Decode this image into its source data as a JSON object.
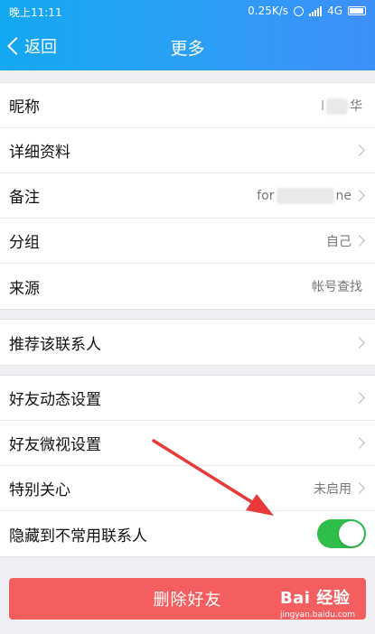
{
  "status_bar": {
    "time": "晚上11:11",
    "network_speed": "0.25K/s",
    "network_type": "4G"
  },
  "nav": {
    "back_label": "返回",
    "title": "更多"
  },
  "groups": [
    {
      "rows": [
        {
          "label": "昵称",
          "value_prefix": "",
          "value_suffix": "华",
          "chevron": false
        },
        {
          "label": "详细资料",
          "value": "",
          "chevron": true
        },
        {
          "label": "备注",
          "value_prefix": "for",
          "value_suffix": "ne",
          "chevron": true
        },
        {
          "label": "分组",
          "value": "自己",
          "chevron": true
        },
        {
          "label": "来源",
          "value": "帐号查找",
          "chevron": false
        }
      ]
    },
    {
      "rows": [
        {
          "label": "推荐该联系人",
          "chevron": true
        }
      ]
    },
    {
      "rows": [
        {
          "label": "好友动态设置",
          "chevron": true
        },
        {
          "label": "好友微视设置",
          "chevron": true
        },
        {
          "label": "特别关心",
          "value": "未启用",
          "chevron": true
        },
        {
          "label": "隐藏到不常用联系人",
          "toggle": true,
          "toggle_on": true
        }
      ]
    }
  ],
  "delete_button": "删除好友",
  "watermark": {
    "main": "Bai 经验",
    "sub": "jingyan.baidu.com"
  },
  "colors": {
    "header_start": "#13a8f0",
    "header_end": "#3d8ff8",
    "toggle_on": "#2fbe4a",
    "delete": "#f45e5e",
    "annotation_arrow": "#e83a3a"
  }
}
